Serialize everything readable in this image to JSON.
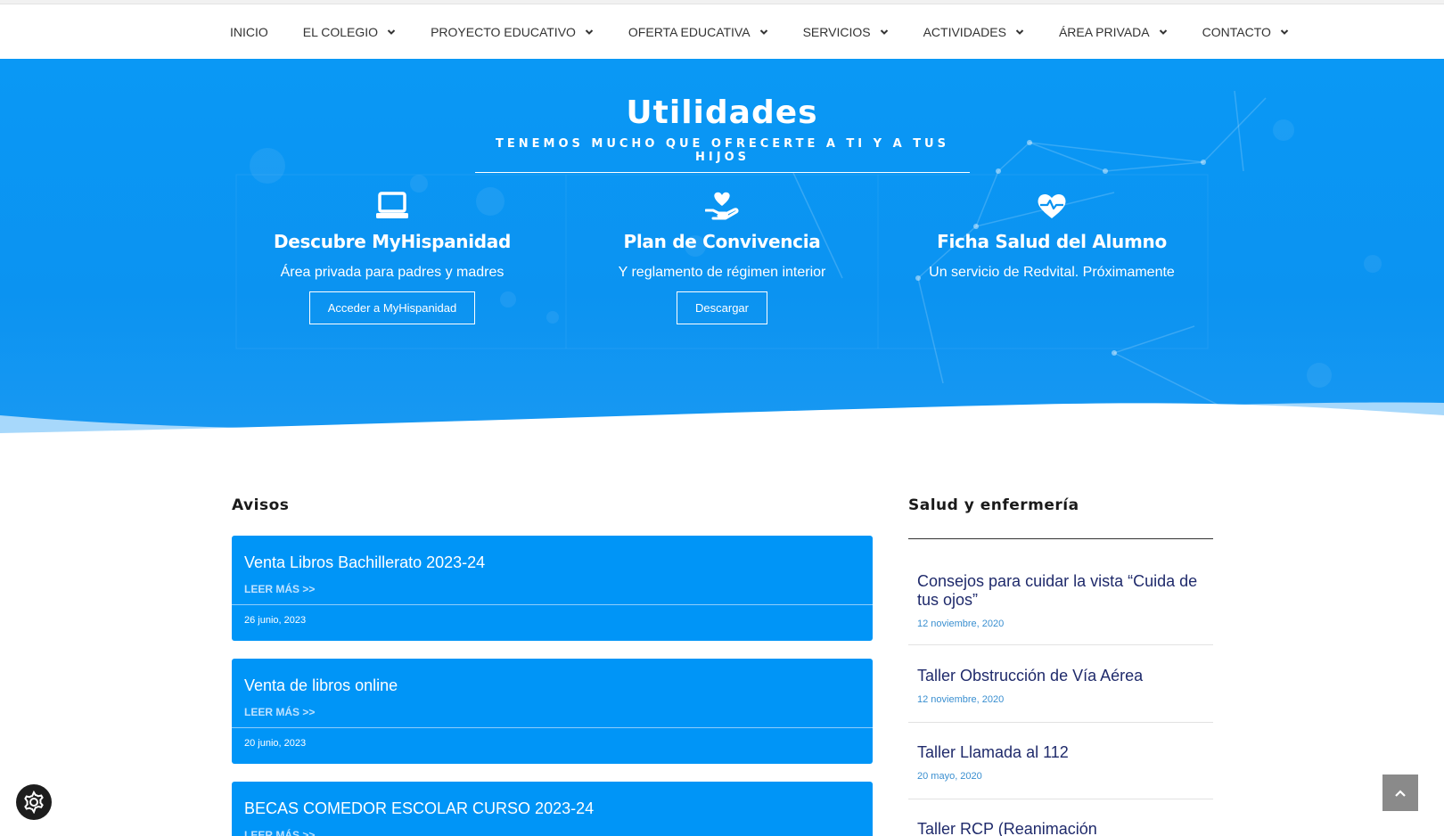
{
  "nav": {
    "items": [
      {
        "label": "INICIO",
        "has_dropdown": false
      },
      {
        "label": "EL COLEGIO",
        "has_dropdown": true
      },
      {
        "label": "PROYECTO EDUCATIVO",
        "has_dropdown": true
      },
      {
        "label": "OFERTA EDUCATIVA",
        "has_dropdown": true
      },
      {
        "label": "SERVICIOS",
        "has_dropdown": true
      },
      {
        "label": "ACTIVIDADES",
        "has_dropdown": true
      },
      {
        "label": "ÁREA PRIVADA",
        "has_dropdown": true
      },
      {
        "label": "CONTACTO",
        "has_dropdown": true
      }
    ]
  },
  "hero": {
    "title": "Utilidades",
    "subtitle": "TENEMOS MUCHO QUE OFRECERTE A TI Y A TUS HIJOS",
    "cards": [
      {
        "icon": "laptop-icon",
        "title": "Descubre MyHispanidad",
        "text": "Área privada para padres y madres",
        "button": "Acceder a MyHispanidad"
      },
      {
        "icon": "hand-heart-icon",
        "title": "Plan de Convivencia",
        "text": "Y reglamento de régimen interior",
        "button": "Descargar"
      },
      {
        "icon": "heartbeat-icon",
        "title": "Ficha Salud del Alumno",
        "text": "Un servicio de Redvital. Próximamente",
        "button": ""
      }
    ]
  },
  "avisos": {
    "title": "Avisos",
    "items": [
      {
        "title": "Venta Libros Bachillerato 2023-24",
        "more": "LEER MÁS >>",
        "date": "26 junio, 2023"
      },
      {
        "title": "Venta de libros online",
        "more": "LEER MÁS >>",
        "date": "20 junio, 2023"
      },
      {
        "title": "BECAS COMEDOR ESCOLAR CURSO 2023-24",
        "more": "LEER MÁS >>",
        "date": ""
      }
    ]
  },
  "salud": {
    "title": "Salud y enfermería",
    "items": [
      {
        "title": "Consejos para cuidar la vista “Cuida de tus ojos”",
        "date": "12 noviembre, 2020"
      },
      {
        "title": "Taller Obstrucción de Vía Aérea",
        "date": "12 noviembre, 2020"
      },
      {
        "title": "Taller Llamada al 112",
        "date": "20 mayo, 2020"
      },
      {
        "title": "Taller RCP (Reanimación",
        "date": ""
      }
    ]
  },
  "colors": {
    "brand_blue": "#0095f7",
    "link_navy": "#1f2a6b",
    "date_blue": "#3a8fd0"
  }
}
